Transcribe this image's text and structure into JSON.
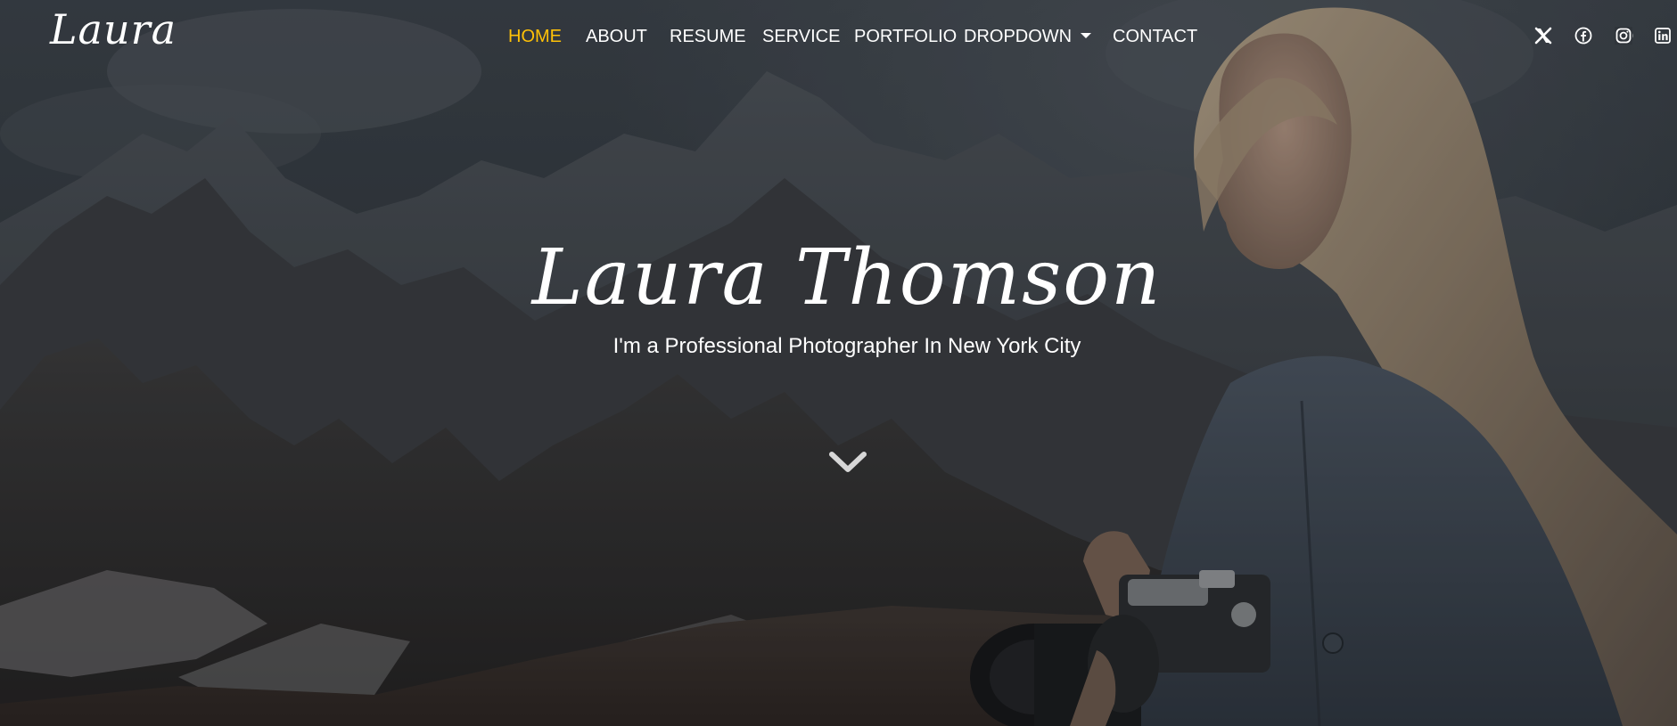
{
  "header": {
    "logo": "Laura",
    "nav": [
      {
        "label": "HOME",
        "active": true
      },
      {
        "label": "ABOUT",
        "active": false
      },
      {
        "label": "RESUME",
        "active": false
      },
      {
        "label": "SERVICE",
        "active": false
      },
      {
        "label": "PORTFOLIO",
        "active": false
      },
      {
        "label": "DROPDOWN",
        "active": false,
        "has_caret": true
      },
      {
        "label": "CONTACT",
        "active": false
      }
    ],
    "social_icons": [
      "x-icon",
      "facebook-icon",
      "instagram-icon",
      "linkedin-icon"
    ]
  },
  "hero": {
    "title": "Laura Thomson",
    "subtitle": "I'm a Professional Photographer In New York City",
    "scroll_icon": "chevron-down-icon"
  },
  "colors": {
    "accent": "#ffc107",
    "text": "#ffffff",
    "overlay": "#2e3338"
  }
}
